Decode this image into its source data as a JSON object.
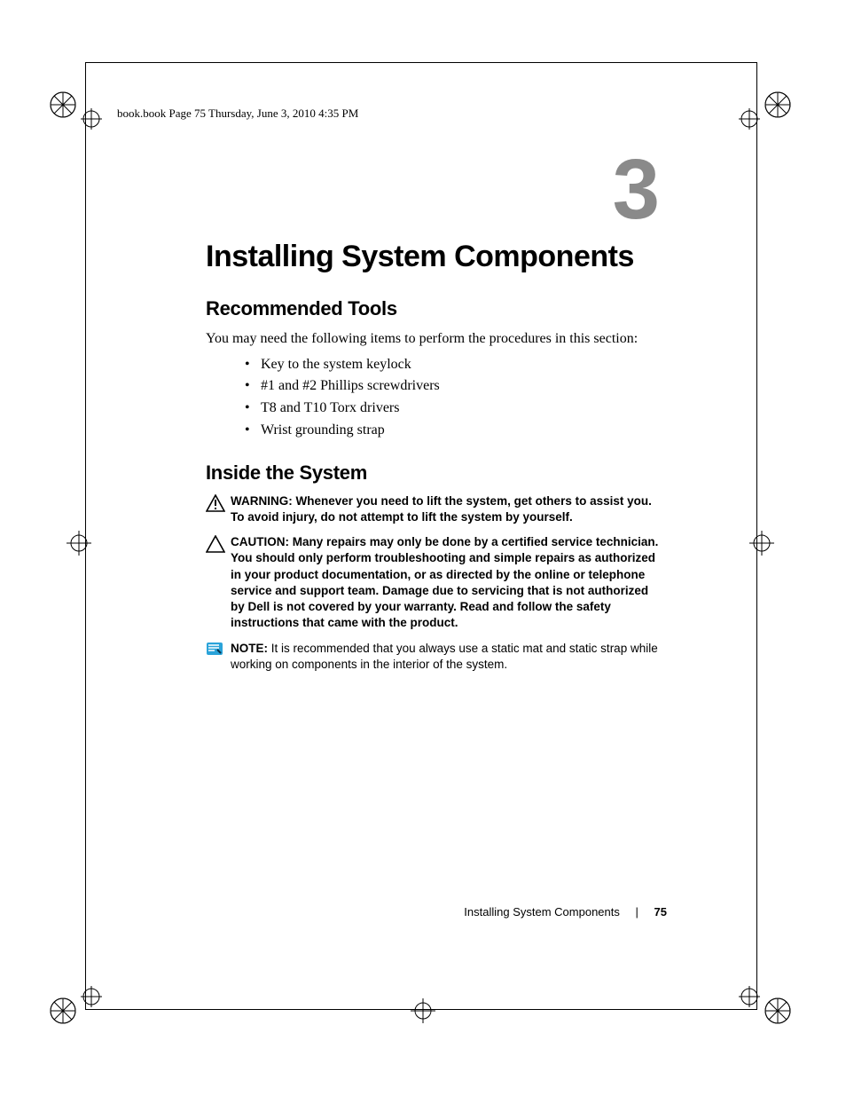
{
  "meta": {
    "running_header": "book.book  Page 75  Thursday, June 3, 2010  4:35 PM"
  },
  "chapter": {
    "number": "3",
    "title": "Installing System Components"
  },
  "sections": {
    "tools": {
      "heading": "Recommended Tools",
      "intro": "You may need the following items to perform the procedures in this section:",
      "items": [
        "Key to the system keylock",
        "#1 and #2 Phillips screwdrivers",
        "T8 and T10 Torx drivers",
        "Wrist grounding strap"
      ]
    },
    "inside": {
      "heading": "Inside the System",
      "warning": {
        "label": "WARNING:",
        "text": "Whenever you need to lift the system, get others to assist you. To avoid injury, do not attempt to lift the system by yourself."
      },
      "caution": {
        "label": "CAUTION:",
        "text": "Many repairs may only be done by a certified service technician. You should only perform troubleshooting and simple repairs as authorized in your product documentation, or as directed by the online or telephone service and support team. Damage due to servicing that is not authorized by Dell is not covered by your warranty. Read and follow the safety instructions that came with the product."
      },
      "note": {
        "label": "NOTE:",
        "text": "It is recommended that you always use a static mat and static strap while working on components in the interior of the system."
      }
    }
  },
  "footer": {
    "section": "Installing System Components",
    "page": "75"
  }
}
